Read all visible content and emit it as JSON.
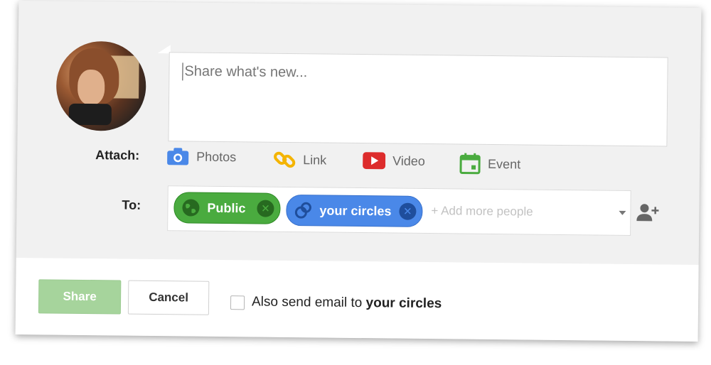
{
  "compose": {
    "placeholder": "Share what's new..."
  },
  "attach": {
    "label": "Attach:",
    "items": [
      {
        "label": "Photos",
        "icon": "camera-icon",
        "color": "#4a88e8"
      },
      {
        "label": "Link",
        "icon": "link-icon",
        "color": "#f4b400"
      },
      {
        "label": "Video",
        "icon": "video-play-icon",
        "color": "#dd2c2c"
      },
      {
        "label": "Event",
        "icon": "calendar-icon",
        "color": "#4aab3f"
      }
    ]
  },
  "to": {
    "label": "To:",
    "chips": [
      {
        "label": "Public",
        "icon": "globe-icon",
        "color": "#4aab3f"
      },
      {
        "label": "your circles",
        "icon": "circles-icon",
        "color": "#4a88e8"
      }
    ],
    "placeholder": "+ Add more people"
  },
  "footer": {
    "share_label": "Share",
    "cancel_label": "Cancel",
    "email_prefix": "Also send email to ",
    "email_target": "your circles"
  }
}
